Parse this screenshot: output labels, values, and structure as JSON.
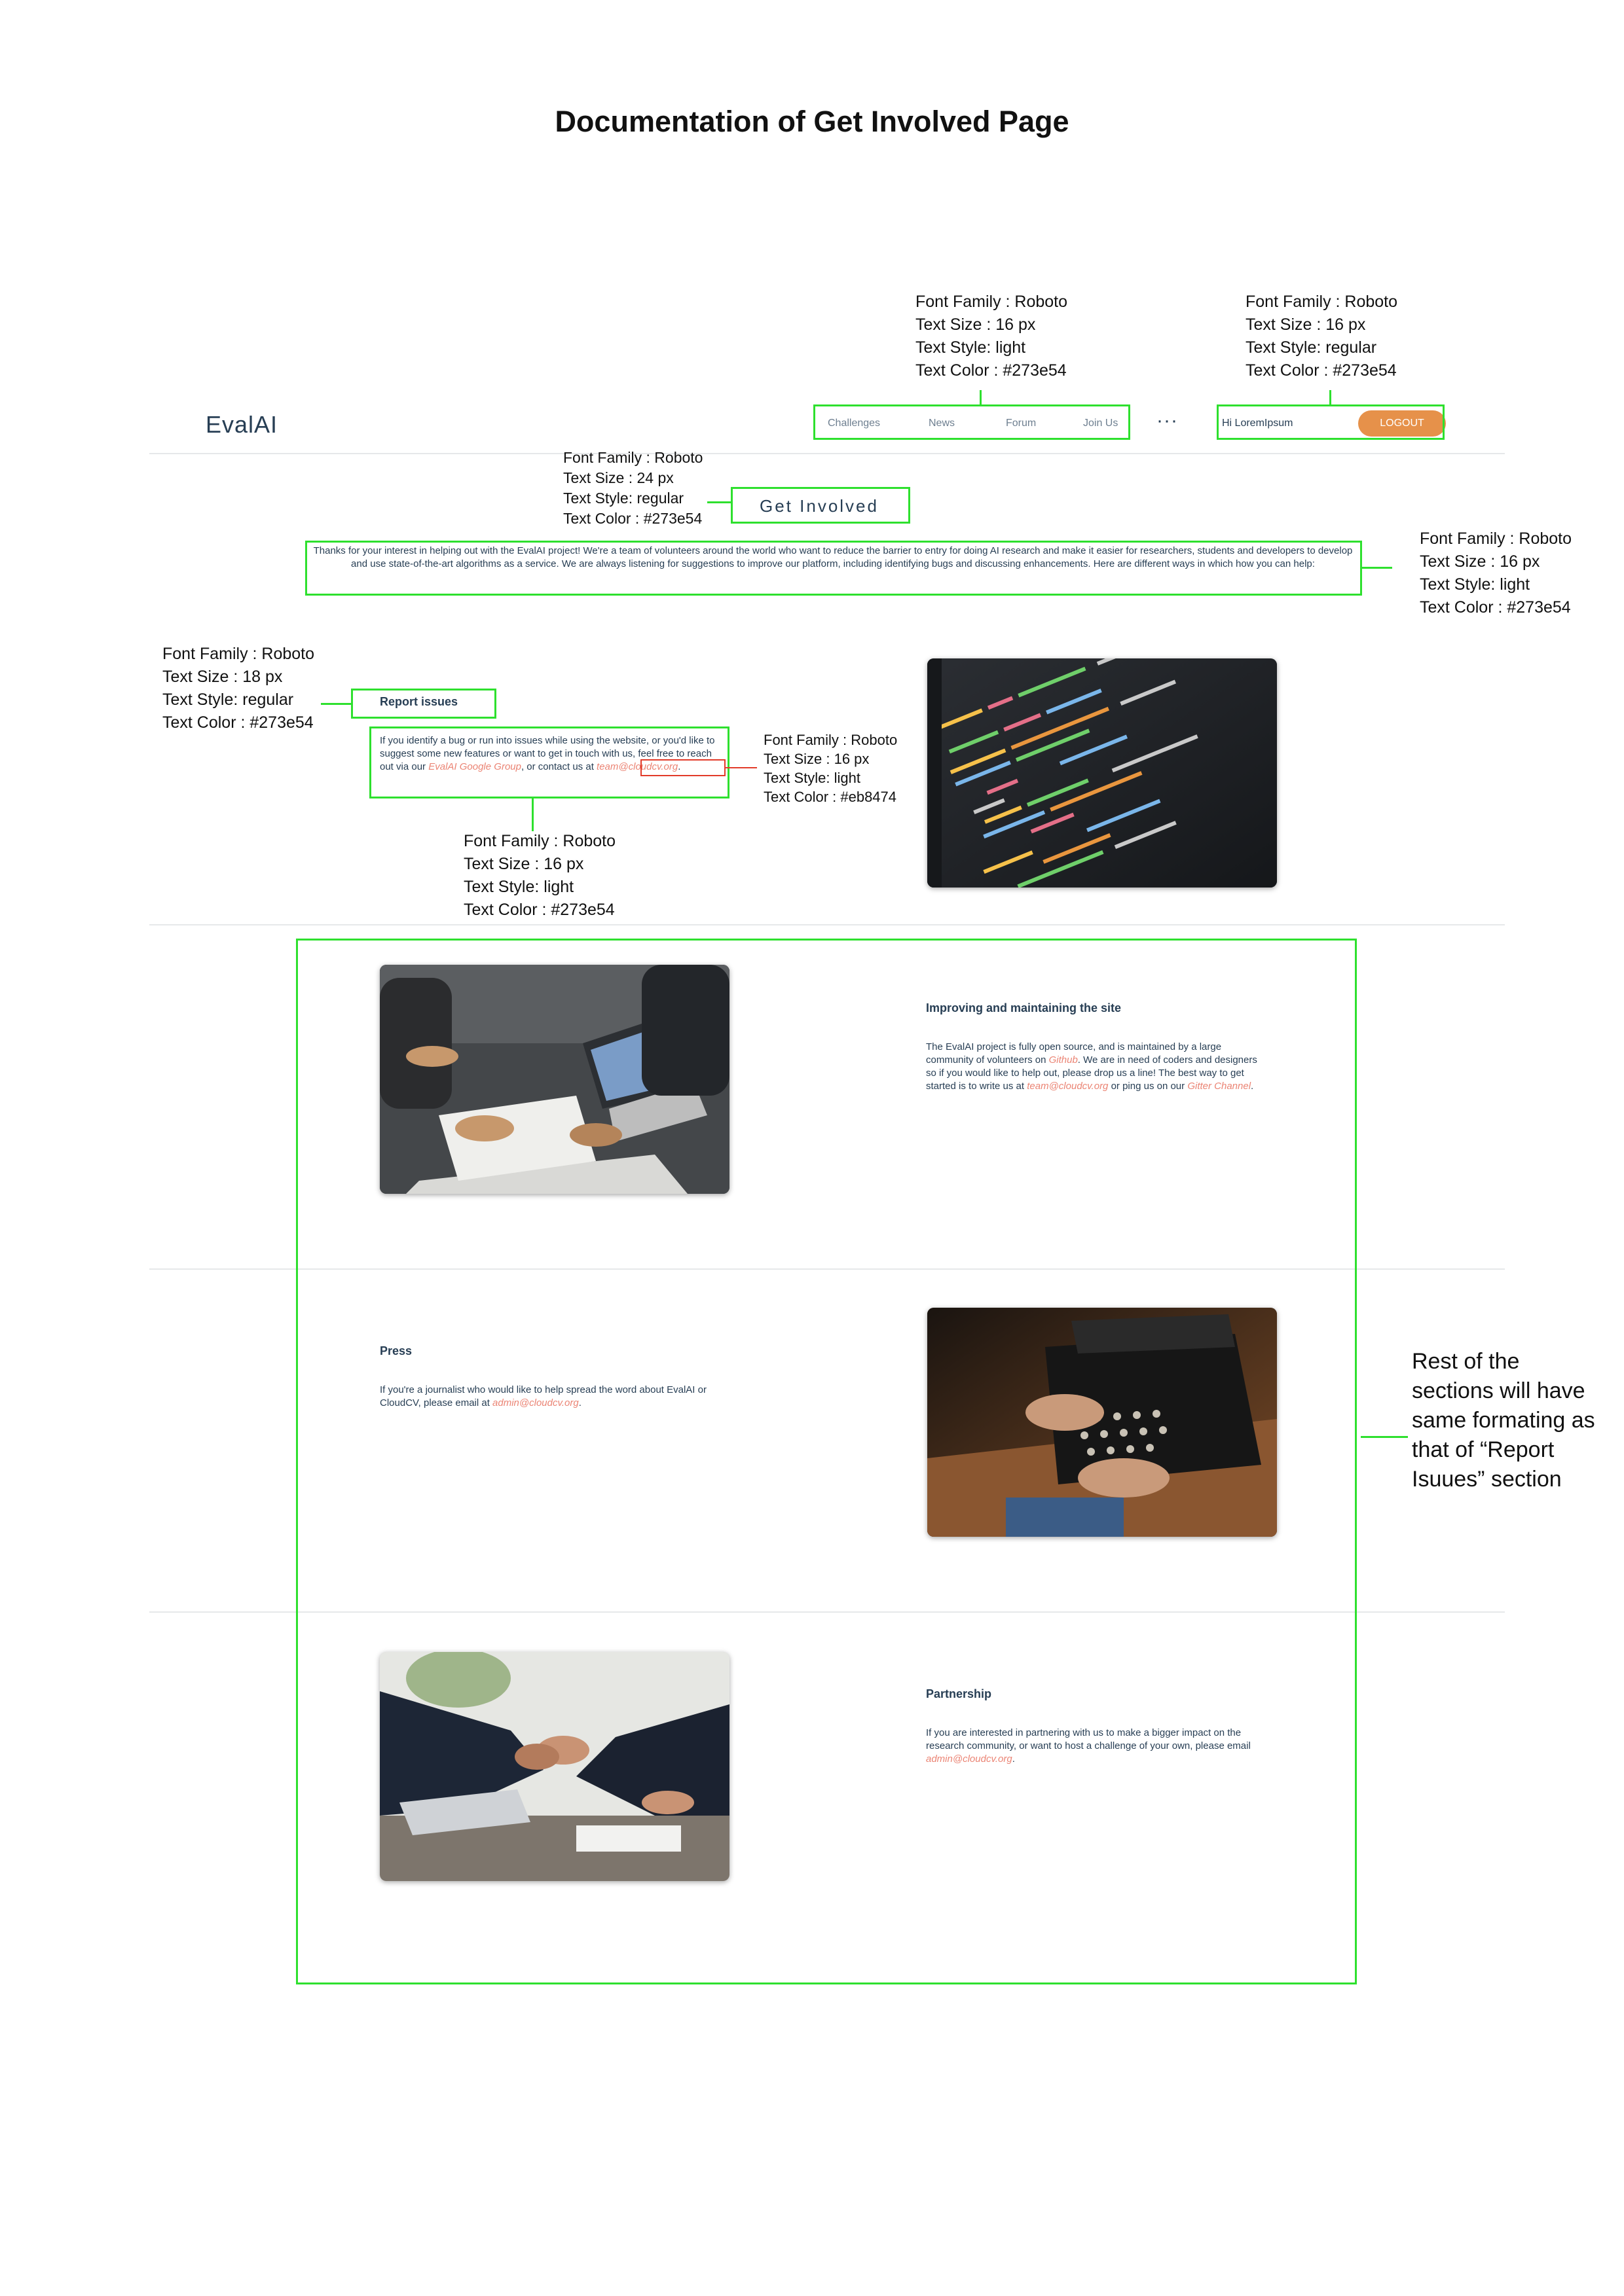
{
  "doc_title": "Documentation of Get Involved Page",
  "navbar": {
    "logo": "EvalAI",
    "items": [
      "Challenges",
      "News",
      "Forum",
      "Join Us"
    ],
    "more": "···",
    "greeting": "Hi LoremIpsum",
    "logout": "LOGOUT"
  },
  "page_title": "Get Involved",
  "intro": "Thanks for your interest in helping out with the EvalAI project! We're a team of volunteers around the world who want to reduce the barrier to entry for doing AI research and make it easier for researchers, students and developers to develop and use state-of-the-art algorithms as a service. We are always listening for suggestions to improve our platform, including identifying bugs and discussing enhancements. Here are different ways in which how you can help:",
  "sections": [
    {
      "title": "Report issues",
      "text_a": "If you identify a bug or run into issues while using the website, or you'd like to suggest some new features or want to get in touch with us, feel free to reach out via our ",
      "link_a": "EvalAI Google Group",
      "text_b": ", or contact us at ",
      "link_b": "team@cloudcv.org",
      "text_c": "."
    },
    {
      "title": "Improving and maintaining the site",
      "text_a": "The EvalAI project is fully open source, and is maintained by a large community of volunteers on ",
      "link_a": "Github",
      "text_b": ". We are in need of coders and designers so if you would like to help out, please drop us a line! The best way to get started is to write us at ",
      "link_b": "team@cloudcv.org",
      "text_c": " or ping us on our ",
      "link_c": "Gitter Channel",
      "text_d": "."
    },
    {
      "title": "Press",
      "text_a": "If you're a journalist who would like to help spread the word about EvalAI or CloudCV, please email at ",
      "link_a": "admin@cloudcv.org",
      "text_b": "."
    },
    {
      "title": "Partnership",
      "text_a": "If you are interested in partnering with us to make a bigger impact on the research community, or want to host a challenge of your own, please email ",
      "link_a": "admin@cloudcv.org",
      "text_b": "."
    }
  ],
  "annotations": {
    "nav": [
      "Font Family : Roboto",
      "Text Size : 16 px",
      "Text Style: light",
      "Text Color :  #273e54"
    ],
    "user": [
      "Font Family : Roboto",
      "Text Size : 16 px",
      "Text Style: regular",
      "Text Color :  #273e54"
    ],
    "title": [
      "Font Family : Roboto",
      "Text Size : 24 px",
      "Text Style: regular",
      "Text Color :  #273e54"
    ],
    "intro": [
      "Font Family : Roboto",
      "Text Size : 16 px",
      "Text Style: light",
      "Text Color :  #273e54"
    ],
    "section_title": [
      "Font Family : Roboto",
      "Text Size : 18 px",
      "Text Style: regular",
      "Text Color :  #273e54"
    ],
    "link": [
      "Font Family : Roboto",
      "Text Size : 16 px",
      "Text Style: light",
      "Text Color :  #eb8474"
    ],
    "section_text": [
      "Font Family : Roboto",
      "Text Size : 16 px",
      "Text Style: light",
      "Text Color :  #273e54"
    ],
    "rest_note": [
      "Rest of the",
      "sections will have",
      "same formating as",
      "that of “Report",
      "Isuues” section"
    ]
  },
  "colors": {
    "text": "#273e54",
    "link": "#eb8474",
    "logout_bg": "#e6914a",
    "annotation_box": "#2ee02e",
    "annotation_link_box": "#e23b2a"
  },
  "icons": [
    "code-screen-image",
    "team-laptop-image",
    "typewriter-image",
    "handshake-image"
  ]
}
